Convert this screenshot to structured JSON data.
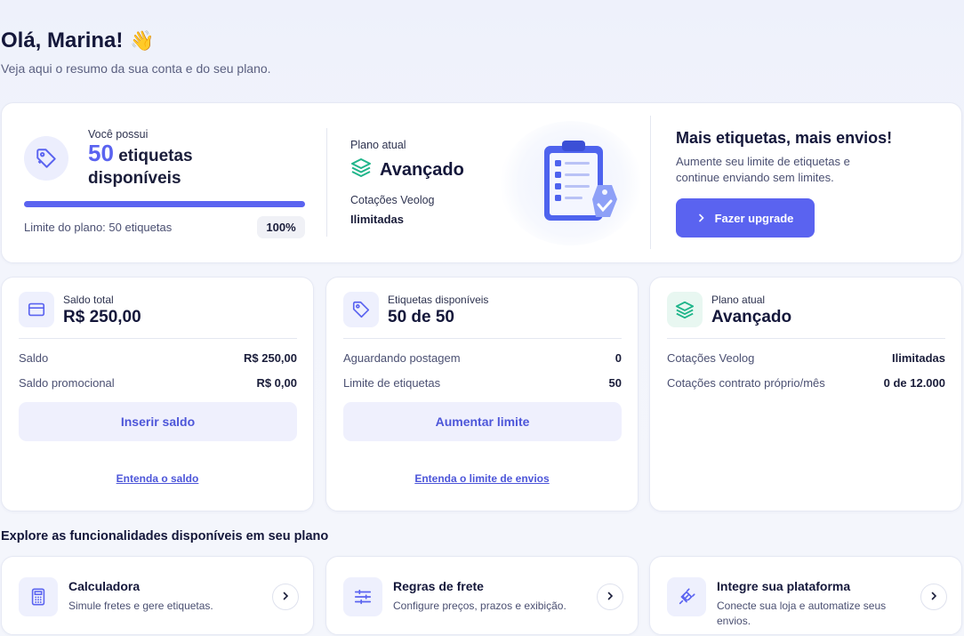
{
  "header": {
    "greeting": "Olá, Marina!",
    "wave_emoji": "👋",
    "subtitle": "Veja aqui o resumo da sua conta e do seu plano."
  },
  "hero": {
    "you_have_label": "Você possui",
    "labels_count": "50",
    "labels_text_1": "etiquetas",
    "labels_text_2": "disponíveis",
    "progress_fraction": 1.0,
    "plan_limit_text": "Limite do plano: 50 etiquetas",
    "percent": "100%",
    "current_plan_label": "Plano atual",
    "plan_name": "Avançado",
    "quotes_label": "Cotações Veolog",
    "quotes_value": "Ilimitadas",
    "upgrade_title": "Mais etiquetas, mais envios!",
    "upgrade_text": "Aumente seu limite de etiquetas e continue enviando sem limites.",
    "upgrade_button": "Fazer upgrade"
  },
  "cards": {
    "balance": {
      "label": "Saldo total",
      "value": "R$ 250,00",
      "rows": [
        {
          "key": "Saldo",
          "value": "R$ 250,00"
        },
        {
          "key": "Saldo promocional",
          "value": "R$ 0,00"
        }
      ],
      "button": "Inserir saldo",
      "link": "Entenda o saldo"
    },
    "labels": {
      "label": "Etiquetas disponíveis",
      "value": "50 de 50",
      "rows": [
        {
          "key": "Aguardando postagem",
          "value": "0"
        },
        {
          "key": "Limite de etiquetas",
          "value": "50"
        }
      ],
      "button": "Aumentar limite",
      "link": "Entenda o limite de envios"
    },
    "plan": {
      "label": "Plano atual",
      "value": "Avançado",
      "rows": [
        {
          "key": "Cotações Veolog",
          "value": "Ilimitadas"
        },
        {
          "key": "Cotações contrato próprio/mês",
          "value": "0 de 12.000"
        }
      ]
    }
  },
  "explore_title": "Explore as funcionalidades disponíveis em seu plano",
  "features": [
    {
      "title": "Calculadora",
      "desc": "Simule fretes e gere etiquetas.",
      "icon": "calculator-icon"
    },
    {
      "title": "Regras de frete",
      "desc": "Configure preços, prazos e exibição.",
      "icon": "sliders-icon"
    },
    {
      "title": "Integre sua plataforma",
      "desc": "Conecte sua loja e automatize seus envios.",
      "icon": "plug-icon"
    }
  ],
  "colors": {
    "primary": "#5a63f0",
    "primary_soft": "#eff0fd",
    "plan_green": "#1fb58a",
    "text_dark": "#14173a"
  }
}
